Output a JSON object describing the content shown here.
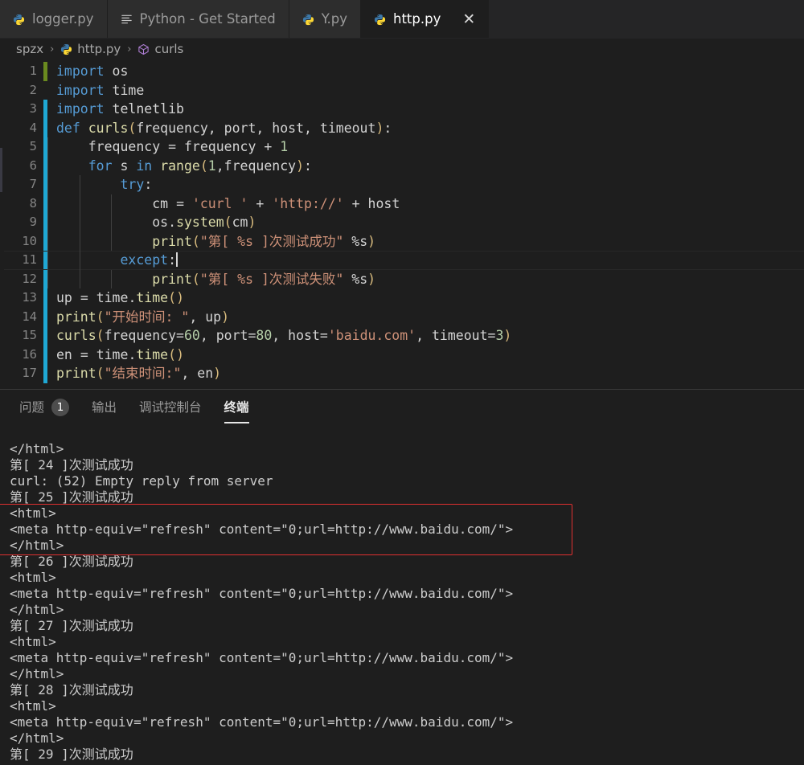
{
  "window": {
    "theme_bg": "#1e1e1e",
    "accent_red": "#e03030"
  },
  "tabbar": {
    "tabs": [
      {
        "label": "logger.py",
        "icon": "python-icon",
        "active": false,
        "closable": false
      },
      {
        "label": "Python - Get Started",
        "icon": "lines-icon",
        "active": false,
        "closable": false
      },
      {
        "label": "Y.py",
        "icon": "python-icon",
        "active": false,
        "closable": false
      },
      {
        "label": "http.py",
        "icon": "python-icon",
        "active": true,
        "closable": true
      }
    ],
    "close_glyph": "✕"
  },
  "breadcrumb": {
    "separator": "›",
    "items": [
      {
        "label": "spzx",
        "icon": "none"
      },
      {
        "label": "http.py",
        "icon": "python-icon"
      },
      {
        "label": "curls",
        "icon": "cube-icon"
      }
    ]
  },
  "editor": {
    "language": "python",
    "current_line": 11,
    "lines": [
      {
        "n": "1",
        "gutter": "green",
        "indent_guides": 0,
        "text": "import os"
      },
      {
        "n": "2",
        "gutter": "none",
        "indent_guides": 0,
        "text": "import time"
      },
      {
        "n": "3",
        "gutter": "blue",
        "indent_guides": 0,
        "text": "import telnetlib"
      },
      {
        "n": "4",
        "gutter": "blue",
        "indent_guides": 0,
        "text": "def curls(frequency, port, host, timeout):"
      },
      {
        "n": "5",
        "gutter": "blue",
        "indent_guides": 1,
        "text": "    frequency = frequency + 1"
      },
      {
        "n": "6",
        "gutter": "blue",
        "indent_guides": 1,
        "text": "    for s in range(1,frequency):"
      },
      {
        "n": "7",
        "gutter": "blue",
        "indent_guides": 2,
        "text": "        try:"
      },
      {
        "n": "8",
        "gutter": "blue",
        "indent_guides": 3,
        "text": "            cm = 'curl ' + 'http://' + host"
      },
      {
        "n": "9",
        "gutter": "blue",
        "indent_guides": 3,
        "text": "            os.system(cm)"
      },
      {
        "n": "10",
        "gutter": "blue",
        "indent_guides": 3,
        "text": "            print(\"第[ %s ]次测试成功\" %s)"
      },
      {
        "n": "11",
        "gutter": "blue",
        "indent_guides": 2,
        "text": "        except:"
      },
      {
        "n": "12",
        "gutter": "blue",
        "indent_guides": 3,
        "text": "            print(\"第[ %s ]次测试失败\" %s)"
      },
      {
        "n": "13",
        "gutter": "blue",
        "indent_guides": 0,
        "text": "up = time.time()"
      },
      {
        "n": "14",
        "gutter": "blue",
        "indent_guides": 0,
        "text": "print(\"开始时间: \", up)"
      },
      {
        "n": "15",
        "gutter": "blue",
        "indent_guides": 0,
        "text": "curls(frequency=60, port=80, host='baidu.com', timeout=3)"
      },
      {
        "n": "16",
        "gutter": "blue",
        "indent_guides": 0,
        "text": "en = time.time()"
      },
      {
        "n": "17",
        "gutter": "blue",
        "indent_guides": 0,
        "text": "print(\"结束时间:\", en)"
      }
    ]
  },
  "panel": {
    "tabs": [
      {
        "label": "问题",
        "badge": "1",
        "active": false
      },
      {
        "label": "输出",
        "badge": null,
        "active": false
      },
      {
        "label": "调试控制台",
        "badge": null,
        "active": false
      },
      {
        "label": "终端",
        "badge": null,
        "active": true
      }
    ],
    "terminal_lines": [
      "</html>",
      "第[ 24 ]次测试成功",
      "curl: (52) Empty reply from server",
      "第[ 25 ]次测试成功",
      "<html>",
      "<meta http-equiv=\"refresh\" content=\"0;url=http://www.baidu.com/\">",
      "</html>",
      "第[ 26 ]次测试成功",
      "<html>",
      "<meta http-equiv=\"refresh\" content=\"0;url=http://www.baidu.com/\">",
      "</html>",
      "第[ 27 ]次测试成功",
      "<html>",
      "<meta http-equiv=\"refresh\" content=\"0;url=http://www.baidu.com/\">",
      "</html>",
      "第[ 28 ]次测试成功",
      "<html>",
      "<meta http-equiv=\"refresh\" content=\"0;url=http://www.baidu.com/\">",
      "</html>",
      "第[ 29 ]次测试成功"
    ],
    "highlight": {
      "start_line_index": 4,
      "line_count": 3,
      "color": "#e03030"
    }
  }
}
